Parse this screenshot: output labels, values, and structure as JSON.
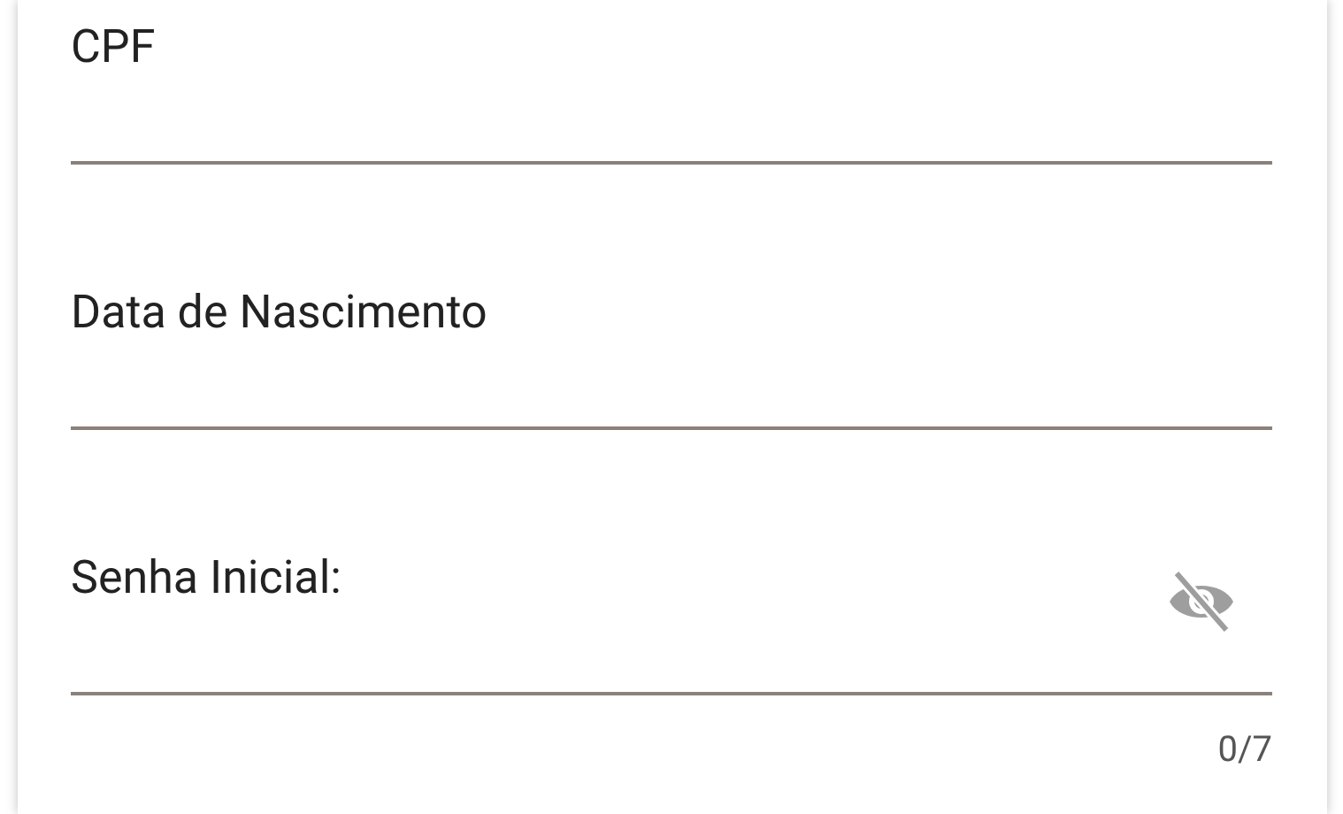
{
  "fields": [
    {
      "kind": "text",
      "placeholder": "CPF"
    },
    {
      "kind": "text",
      "placeholder": "Data de Nascimento"
    },
    {
      "kind": "password",
      "placeholder": "Senha Inicial:",
      "password_visible": false,
      "counter": "0/7"
    }
  ]
}
